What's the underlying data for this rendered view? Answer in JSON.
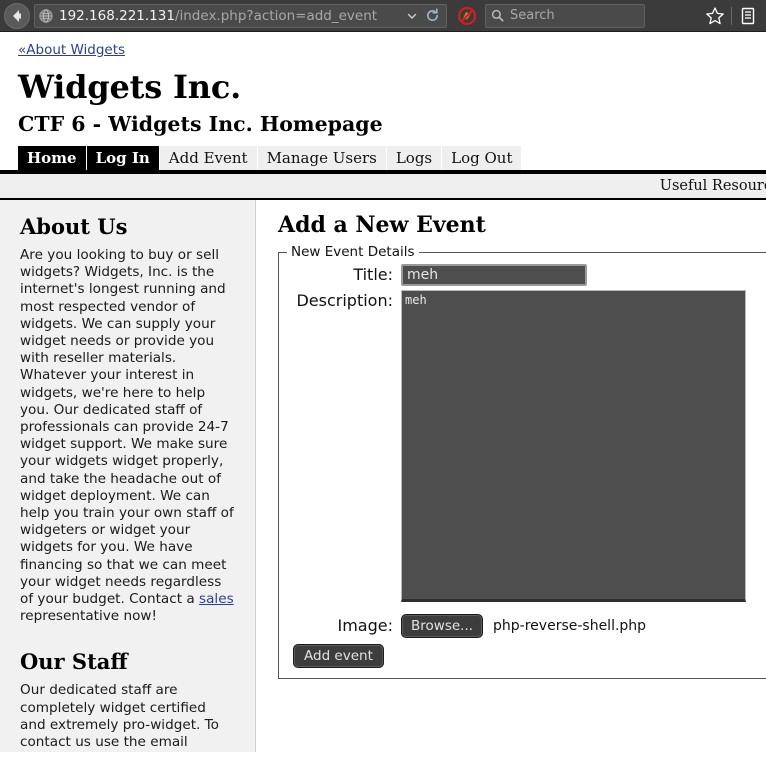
{
  "browser": {
    "back_icon": "back-arrow-icon",
    "site_icon": "globe-icon",
    "url_host": "192.168.221.131",
    "url_path": "/index.php?action=add_event",
    "dropdown_icon": "chevron-down-icon",
    "reload_icon": "reload-icon",
    "noscript_icon": "noscript-blocked-icon",
    "search_icon": "search-icon",
    "search_placeholder": "Search",
    "search_value": "",
    "bookmark_icon": "star-icon",
    "library_icon": "library-icon"
  },
  "page": {
    "breadcrumb": "«About Widgets",
    "site_title": "Widgets Inc.",
    "site_subtitle": "CTF 6 - Widgets Inc. Homepage",
    "resources_label": "Useful Resources"
  },
  "nav": {
    "tabs": [
      {
        "label": "Home",
        "active": true
      },
      {
        "label": "Log In",
        "active": true
      },
      {
        "label": "Add Event",
        "active": false
      },
      {
        "label": "Manage Users",
        "active": false
      },
      {
        "label": "Logs",
        "active": false
      },
      {
        "label": "Log Out",
        "active": false
      }
    ]
  },
  "sidebar": {
    "about_heading": "About Us",
    "about_text_before_link": "Are you looking to buy or sell widgets? Widgets, Inc. is the internet's longest running and most respected vendor of widgets. We can supply your widget needs or provide you with reseller materials. Whatever your interest in widgets, we're here to help you. Our dedicated staff of professionals can provide 24-7 widget support. We make sure your widgets widget properly, and take the headache out of widget deployment. We can help you train your own staff of widgeters or widget your widgets for you. We have financing so that we can meet your widget needs regardless of your budget. Contact a ",
    "about_link": "sales",
    "about_text_after_link": " representative now!",
    "staff_heading": "Our Staff",
    "staff_text": "Our dedicated staff are completely widget certified and extremely pro-widget. To contact us use the email addresses below:"
  },
  "main": {
    "title": "Add a New Event",
    "fieldset_legend": "New Event Details",
    "title_label": "Title:",
    "title_value": "meh",
    "title_placeholder": "",
    "description_label": "Description:",
    "description_value": "meh",
    "description_placeholder": "",
    "image_label": "Image:",
    "browse_label": "Browse...",
    "file_name": "php-reverse-shell.php",
    "submit_label": "Add event"
  },
  "colors": {
    "chrome_bg": "#3b3b3b",
    "input_bg": "#4e4e4e",
    "link": "#2a3f96",
    "active_tab_bg": "#000000",
    "sidebar_bg": "#f1f1f1"
  }
}
